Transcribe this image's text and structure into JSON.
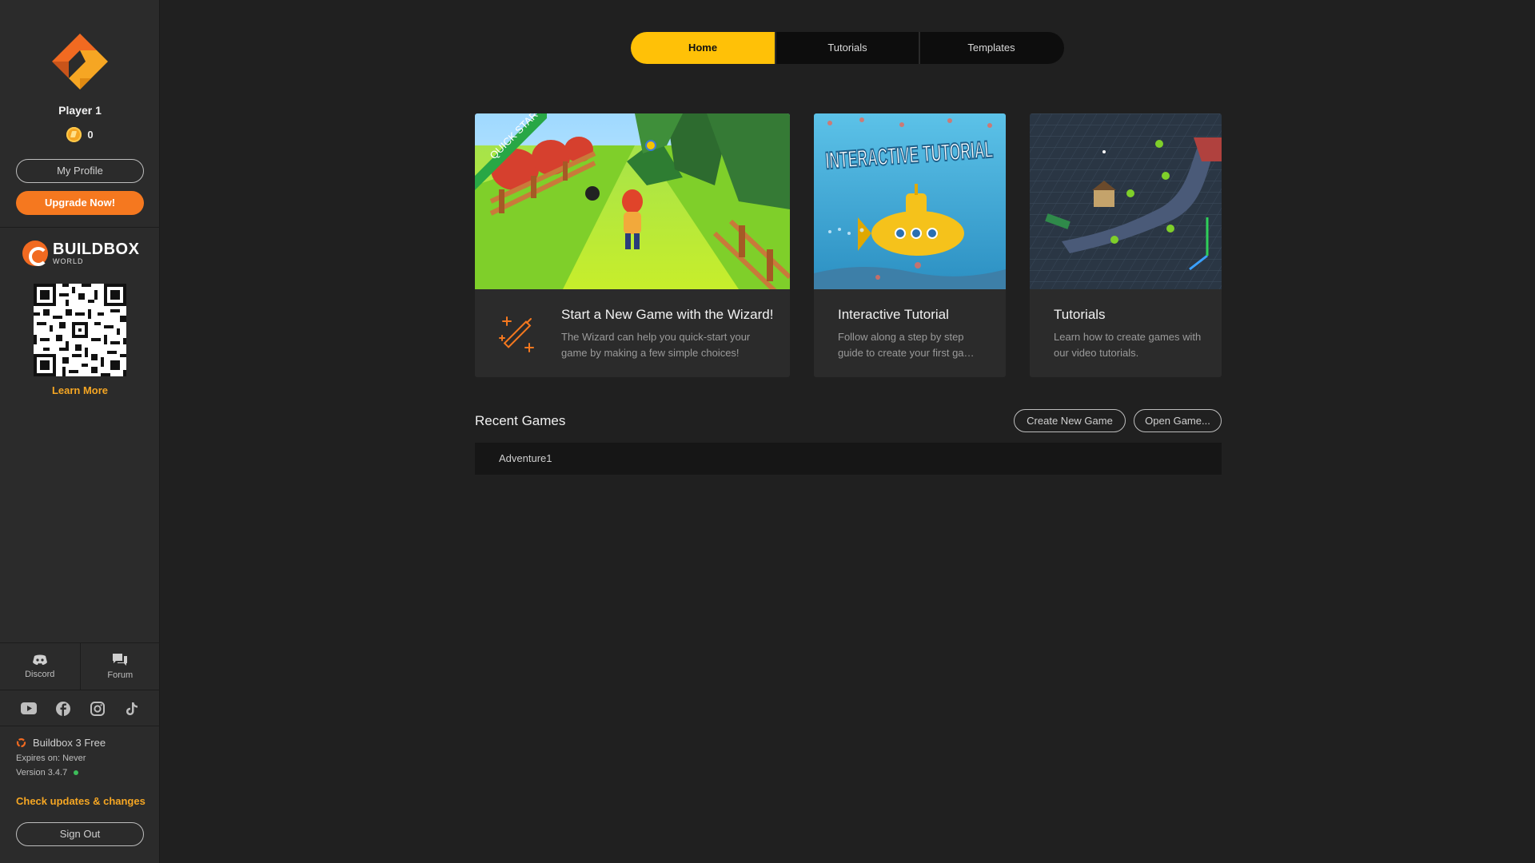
{
  "sidebar": {
    "player_name": "Player 1",
    "coins": "0",
    "my_profile": "My Profile",
    "upgrade": "Upgrade Now!",
    "buildbox_world": {
      "line1": "BUILDBOX",
      "line2": "WORLD"
    },
    "learn_more": "Learn More",
    "community": [
      {
        "label": "Discord",
        "icon": "discord-icon"
      },
      {
        "label": "Forum",
        "icon": "forum-icon"
      }
    ],
    "social_icons": [
      "youtube-icon",
      "facebook-icon",
      "instagram-icon",
      "tiktok-icon"
    ],
    "product": "Buildbox 3 Free",
    "expires": "Expires on: Never",
    "version": "Version 3.4.7",
    "check_updates": "Check updates & changes",
    "sign_out": "Sign Out"
  },
  "tabs": [
    {
      "label": "Home",
      "active": true
    },
    {
      "label": "Tutorials",
      "active": false
    },
    {
      "label": "Templates",
      "active": false
    }
  ],
  "cards": [
    {
      "title": "Start a New Game with the Wizard!",
      "desc": "The Wizard can help you quick-start your game by making a few simple choices!",
      "ribbon": "QUICK START!",
      "icon": "magic-wand-icon"
    },
    {
      "title": "Interactive Tutorial",
      "desc": "Follow along a step by step guide to create your first ga…",
      "image_text": "INTERACTIVE TUTORIAL"
    },
    {
      "title": "Tutorials",
      "desc": "Learn how to create games with our video tutorials."
    }
  ],
  "recent": {
    "title": "Recent Games",
    "create": "Create New Game",
    "open": "Open Game...",
    "games": [
      "Adventure1"
    ]
  },
  "colors": {
    "accent": "#ffc107",
    "orange": "#f5781f",
    "link": "#f5a623",
    "bg": "#202020",
    "sidebar": "#2b2b2b"
  }
}
